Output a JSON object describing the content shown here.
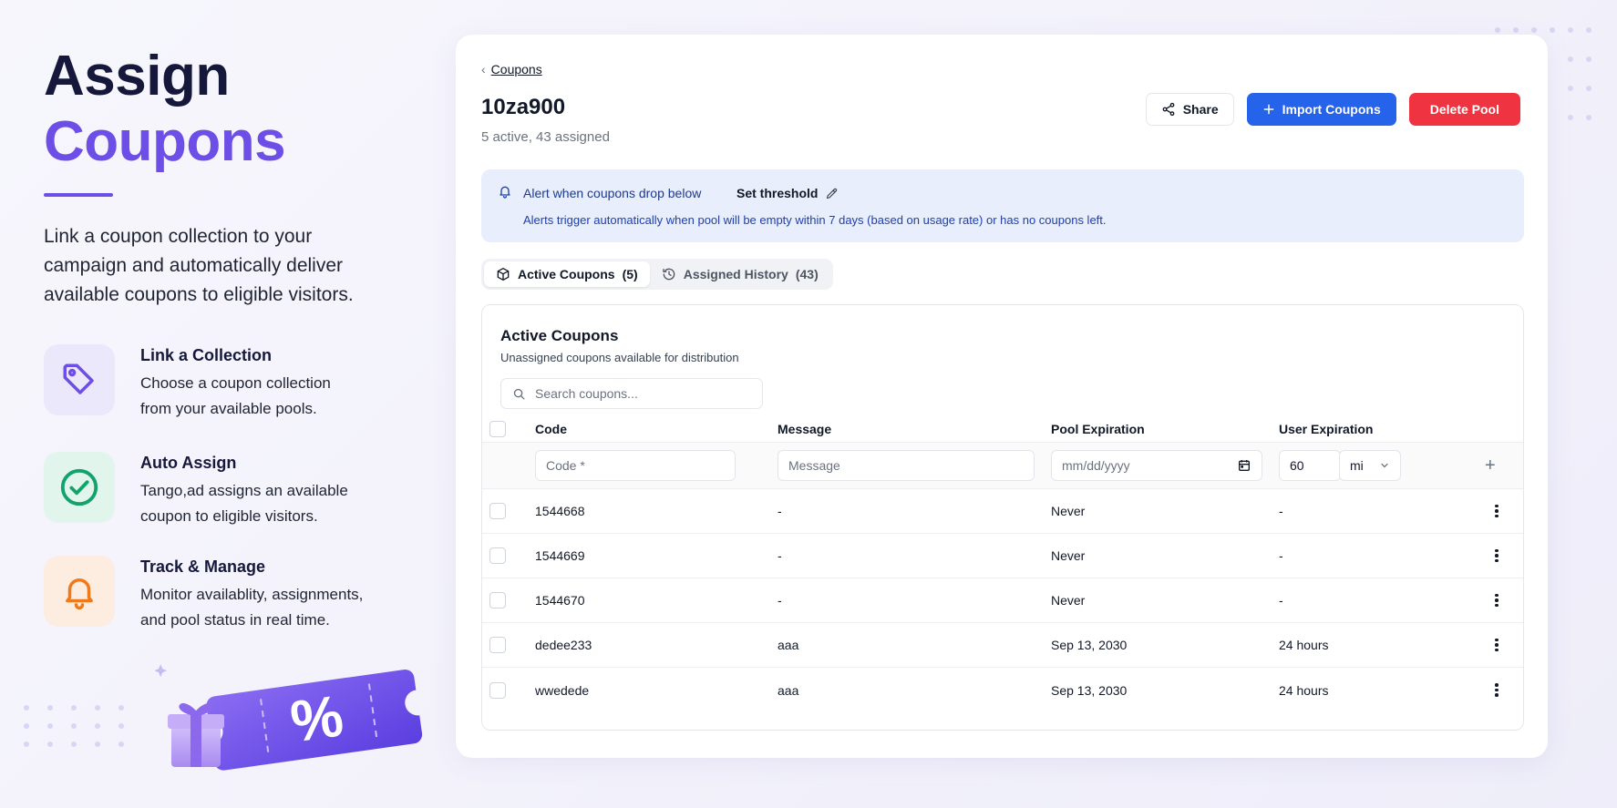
{
  "hero": {
    "title_line1": "Assign",
    "title_line2": "Coupons",
    "description": "Link a coupon collection to your campaign and automatically deliver available coupons to eligible visitors."
  },
  "features": [
    {
      "icon": "tag-icon",
      "title": "Link a Collection",
      "text_line1": "Choose a coupon collection",
      "text_line2": "from your available pools."
    },
    {
      "icon": "check-circle-icon",
      "title": "Auto Assign",
      "text_line1": "Tango,ad assigns an available",
      "text_line2": "coupon to eligible visitors."
    },
    {
      "icon": "bell-icon",
      "title": "Track & Manage",
      "text_line1": "Monitor availablity, assignments,",
      "text_line2": "and pool status in real time."
    }
  ],
  "colors": {
    "accent": "#6d4ee6",
    "primary": "#2563eb",
    "danger": "#ef3340",
    "alert_bg": "#e8eefb"
  },
  "breadcrumb": {
    "label": "Coupons"
  },
  "pool": {
    "name": "10za900",
    "summary": "5 active, 43 assigned"
  },
  "actions": {
    "share": "Share",
    "import": "Import Coupons",
    "delete": "Delete Pool"
  },
  "alert": {
    "label": "Alert when coupons drop below",
    "threshold_label": "Set threshold",
    "description": "Alerts trigger automatically when pool will be empty within 7 days (based on usage rate) or has no coupons left."
  },
  "tabs": [
    {
      "label": "Active Coupons",
      "count": "(5)",
      "active": true
    },
    {
      "label": "Assigned History",
      "count": "(43)",
      "active": false
    }
  ],
  "panel": {
    "title": "Active Coupons",
    "subtitle": "Unassigned coupons available for distribution",
    "search_placeholder": "Search coupons..."
  },
  "table": {
    "columns": [
      "Code",
      "Message",
      "Pool Expiration",
      "User Expiration"
    ],
    "entry": {
      "code_placeholder": "Code *",
      "message_placeholder": "Message",
      "date_placeholder": "mm/dd/yyyy",
      "user_expiration_value": "60",
      "unit_value": "mi",
      "add_symbol": "+"
    },
    "rows": [
      {
        "code": "1544668",
        "message": "-",
        "pool_expiration": "Never",
        "user_expiration": "-"
      },
      {
        "code": "1544669",
        "message": "-",
        "pool_expiration": "Never",
        "user_expiration": "-"
      },
      {
        "code": "1544670",
        "message": "-",
        "pool_expiration": "Never",
        "user_expiration": "-"
      },
      {
        "code": "dedee233",
        "message": "aaa",
        "pool_expiration": "Sep 13, 2030",
        "user_expiration": "24 hours"
      },
      {
        "code": "wwedede",
        "message": "aaa",
        "pool_expiration": "Sep 13, 2030",
        "user_expiration": "24 hours"
      }
    ]
  }
}
